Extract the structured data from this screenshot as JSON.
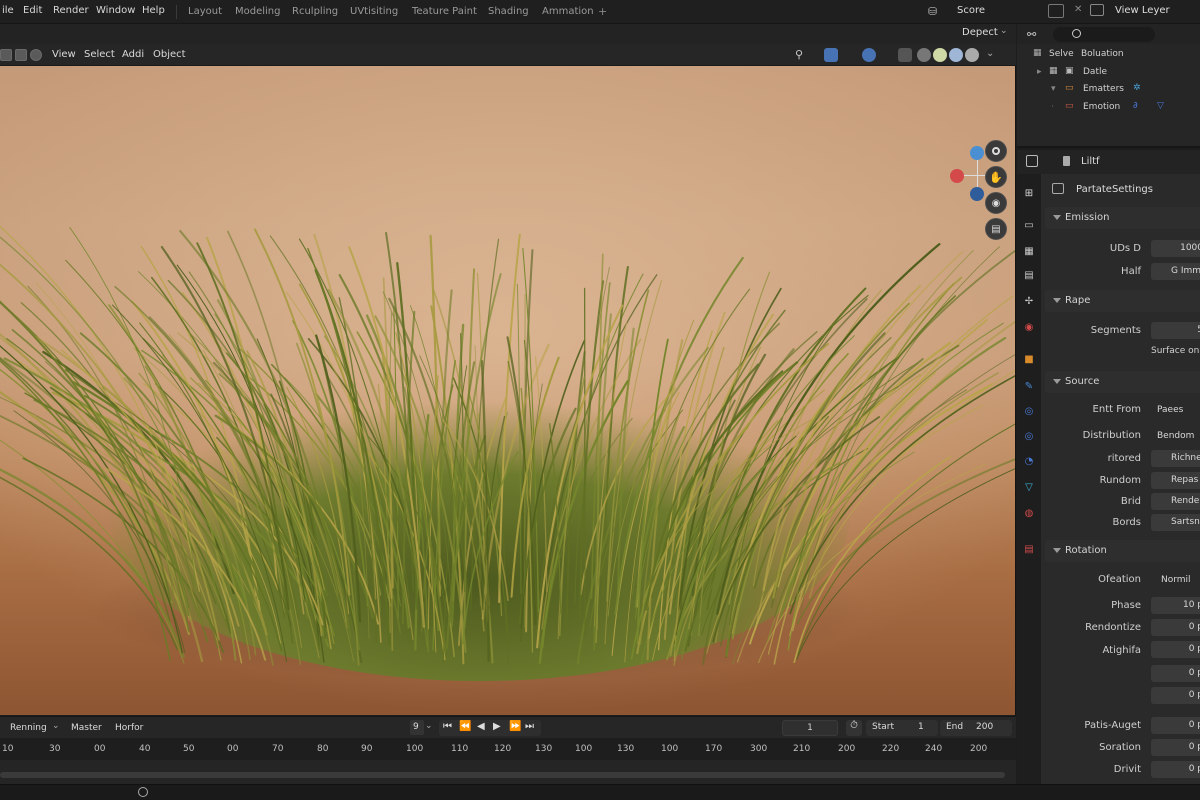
{
  "menu": {
    "file": "ile",
    "edit": "Edit",
    "render": "Render",
    "window": "Window",
    "help": "Help"
  },
  "workspaces": [
    "Layout",
    "Modeling",
    "Rculpling",
    "UVtisiting",
    "Teature Paint",
    "Shading",
    "Ammation"
  ],
  "scene": {
    "label": "Score",
    "view_layer": "View Leyer"
  },
  "viewport_header": {
    "mode": "Depect",
    "view": "View",
    "select": "Select",
    "add": "Addi",
    "object": "Object"
  },
  "outliner": {
    "root": "Selve",
    "root2": "Boluation",
    "items": [
      {
        "label": "Datle"
      },
      {
        "label": "Ematters"
      },
      {
        "label": "Emotion"
      }
    ]
  },
  "properties": {
    "object_name": "Liltf",
    "settings_name": "PartateSettings",
    "emission": {
      "title": "Emission",
      "uds_label": "UDs D",
      "uds_value": "1000",
      "half_label": "Half",
      "half_value": "G Immi"
    },
    "rape": {
      "title": "Rape",
      "segments_label": "Segments",
      "segments_value": "5",
      "surface": "Surface on"
    },
    "source": {
      "title": "Source",
      "emit_from_label": "Entt From",
      "emit_from_value": "Paees",
      "distribution_label": "Distribution",
      "distribution_value": "Bendom",
      "ritored_label": "ritored",
      "ritored_value": "Richne",
      "rundom_label": "Rundom",
      "rundom_value": "Repas",
      "brid_label": "Brid",
      "brid_value": "Rende",
      "bords_label": "Bords",
      "bords_value": "Sartsn"
    },
    "rotation": {
      "title": "Rotation",
      "ofeation_label": "Ofeation",
      "ofeation_value": "Normil",
      "phase_label": "Phase",
      "phase_value": "10 p",
      "rendontize_label": "Rendontize",
      "rendontize_value": "0 p",
      "atighifa_label": "Atighifa",
      "atighifa_value": "0 p",
      "extra1": "0 p",
      "extra2": "0 p",
      "patis_label": "Patis-Auget",
      "patis_value": "0 p",
      "soration_label": "Soration",
      "soration_value": "0 p",
      "drivit_label": "Drivit",
      "drivit_value": "0 p"
    }
  },
  "timeline": {
    "playback": "Renning",
    "master": "Master",
    "horfor": "Horfor",
    "keying": "9",
    "current_frame": "1",
    "start_label": "Start",
    "start_value": "1",
    "end_label": "End",
    "end_value": "200",
    "ticks": [
      "10",
      "30",
      "00",
      "40",
      "50",
      "00",
      "70",
      "80",
      "90",
      "100",
      "110",
      "120",
      "130",
      "100",
      "130",
      "100",
      "170",
      "300",
      "210",
      "200",
      "220",
      "240",
      "200"
    ]
  },
  "colors": {
    "accent": "#4772b3",
    "grass": "#6b7a2c",
    "sand": "#b87a4a"
  }
}
